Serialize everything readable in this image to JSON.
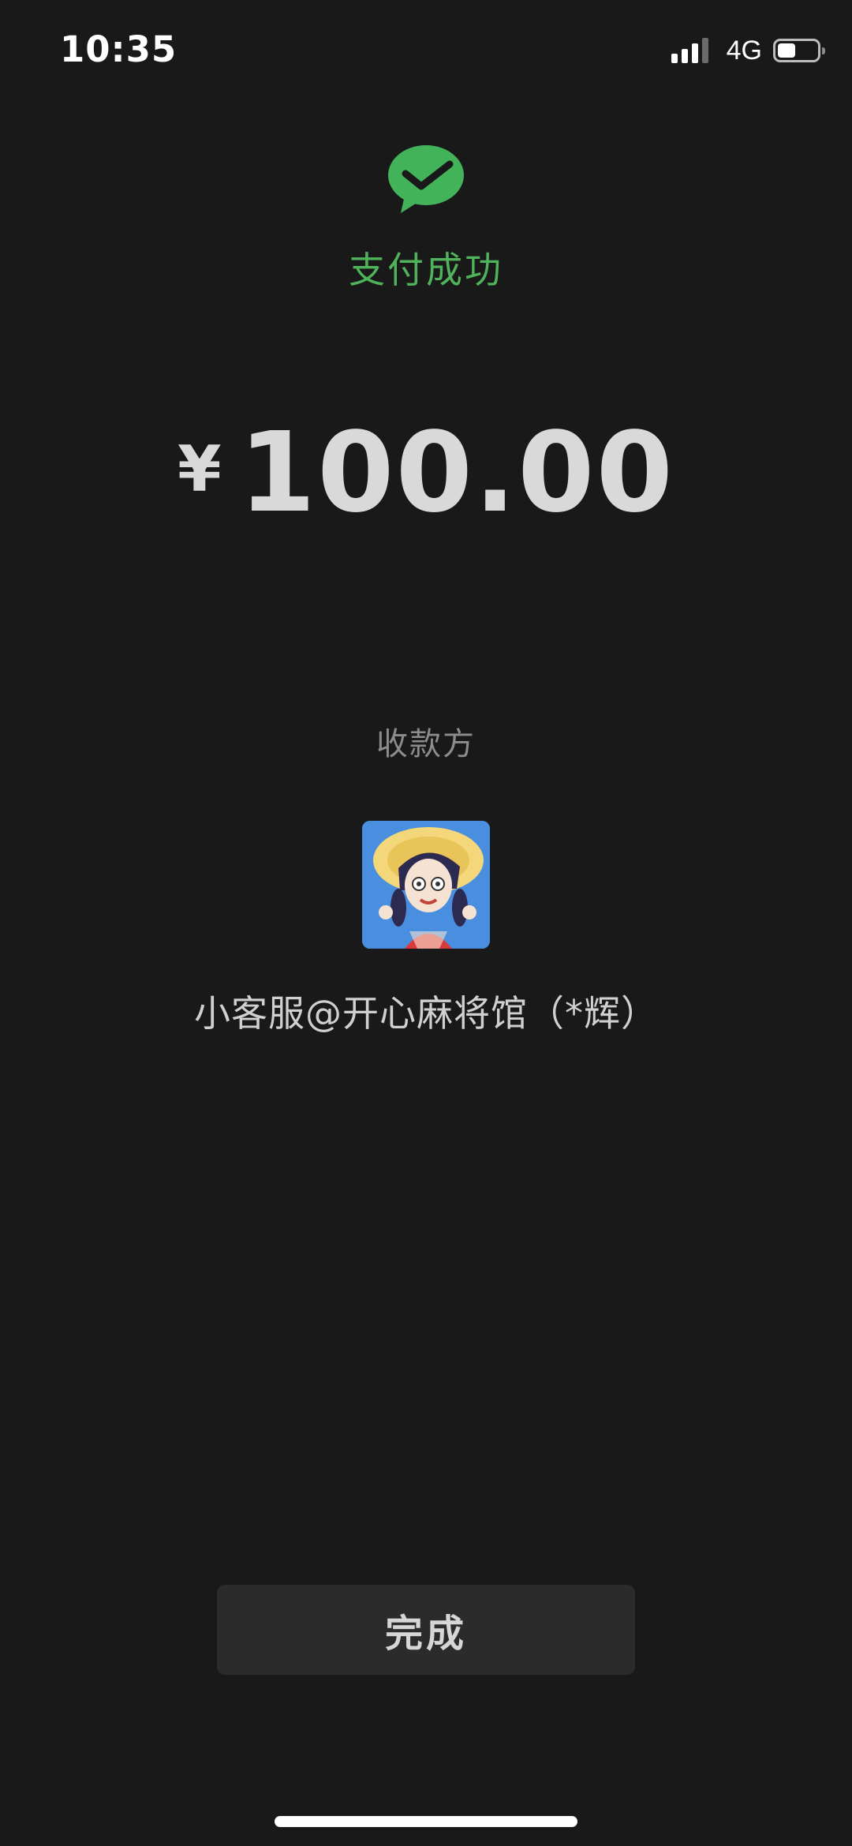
{
  "status_bar": {
    "time": "10:35",
    "network": "4G",
    "signal_bars": 4,
    "battery_level": 0.45,
    "icons": [
      "signal-icon",
      "battery-icon"
    ]
  },
  "result": {
    "icon": "wechat-pay-check-icon",
    "title": "支付成功",
    "accent_color": "#4fb35b"
  },
  "amount": {
    "currency": "¥",
    "value": "100.00"
  },
  "payee": {
    "label": "收款方",
    "avatar": "avatar-illustration",
    "name": "小客服@开心麻将馆（*辉）"
  },
  "actions": {
    "done_label": "完成"
  },
  "colors": {
    "background": "#191919",
    "button": "#2b2b2b"
  }
}
